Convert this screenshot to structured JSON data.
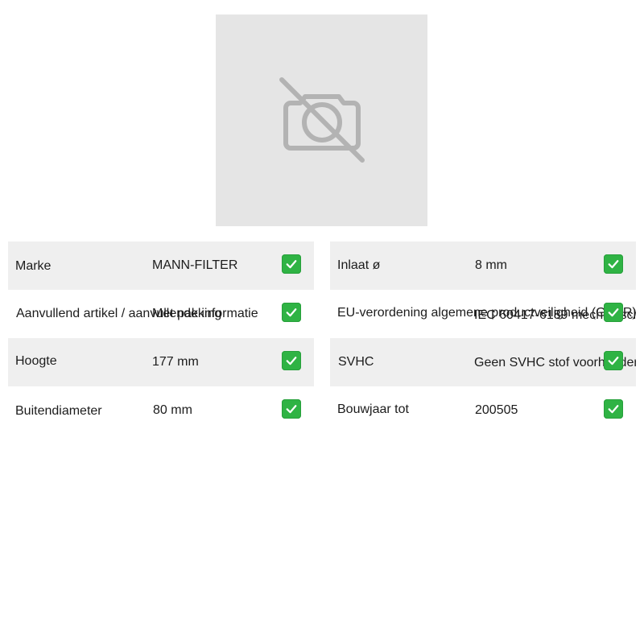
{
  "image": {
    "icon": "camera-off-icon"
  },
  "left_specs": [
    {
      "label": "Marke",
      "value": "MANN-FILTER",
      "status": "check-icon"
    },
    {
      "label": "Aanvullend artikel / aanvullende informatie",
      "value": "Met pakking",
      "status": "check-icon"
    },
    {
      "label": "Hoogte",
      "value": "177 mm",
      "status": "check-icon"
    },
    {
      "label": "Buitendiameter",
      "value": "80 mm",
      "status": "check-icon"
    }
  ],
  "right_specs": [
    {
      "label": "Inlaat ø",
      "value": "8 mm",
      "status": "check-icon"
    },
    {
      "label": "EU-verordening algemene productveiligheid (GPSR)",
      "value": "IEC 60417-6189 mechanisch",
      "status": "check-icon"
    },
    {
      "label": "SVHC",
      "value": "Geen SVHC stof voorhanden",
      "status": "check-icon"
    },
    {
      "label": "Bouwjaar tot",
      "value": "200505",
      "status": "check-icon"
    }
  ],
  "colors": {
    "shaded_row": "#efefef",
    "placeholder_bg": "#e5e5e5",
    "check_green": "#2fb344"
  }
}
